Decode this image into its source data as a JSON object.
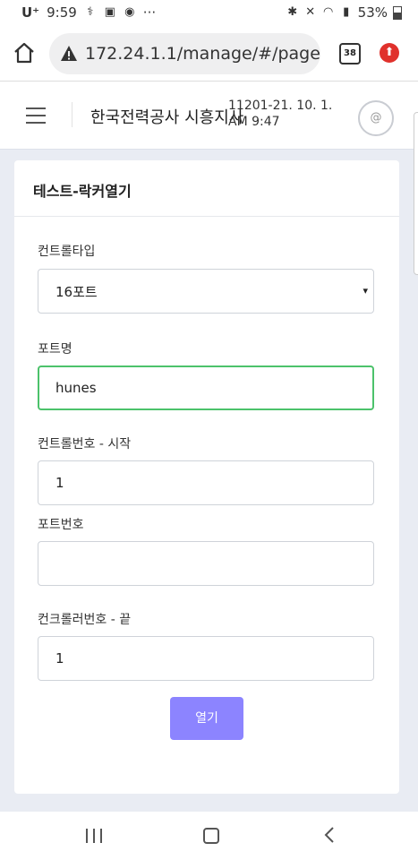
{
  "status_bar": {
    "carrier": "U⁺",
    "time": "9:59",
    "overflow": "···",
    "battery": "53%"
  },
  "browser": {
    "url": "172.24.1.1/manage/#/page",
    "tab_count": "38"
  },
  "app": {
    "title": "한국전력공사 시흥지사",
    "datetime": "11201-21. 10. 1. AM 9:47",
    "avatar_glyph": "@"
  },
  "card": {
    "title": "테스트-락커열기",
    "fields": {
      "control_type": {
        "label": "컨트롤타입",
        "value": "16포트",
        "caret": "▾"
      },
      "port_name": {
        "label": "포트명",
        "value": "hunes"
      },
      "control_start": {
        "label": "컨트롤번호 - 시작",
        "value": "1"
      },
      "port_number": {
        "label": "포트번호",
        "value": ""
      },
      "control_end": {
        "label": "컨크롤러번호 - 끝",
        "value": "1"
      }
    },
    "open_button": "열기"
  },
  "colors": {
    "accent": "#8c84ff",
    "focus_border": "#4cc26b",
    "upload": "#e0312c",
    "page_bg": "#e9ecf3"
  }
}
